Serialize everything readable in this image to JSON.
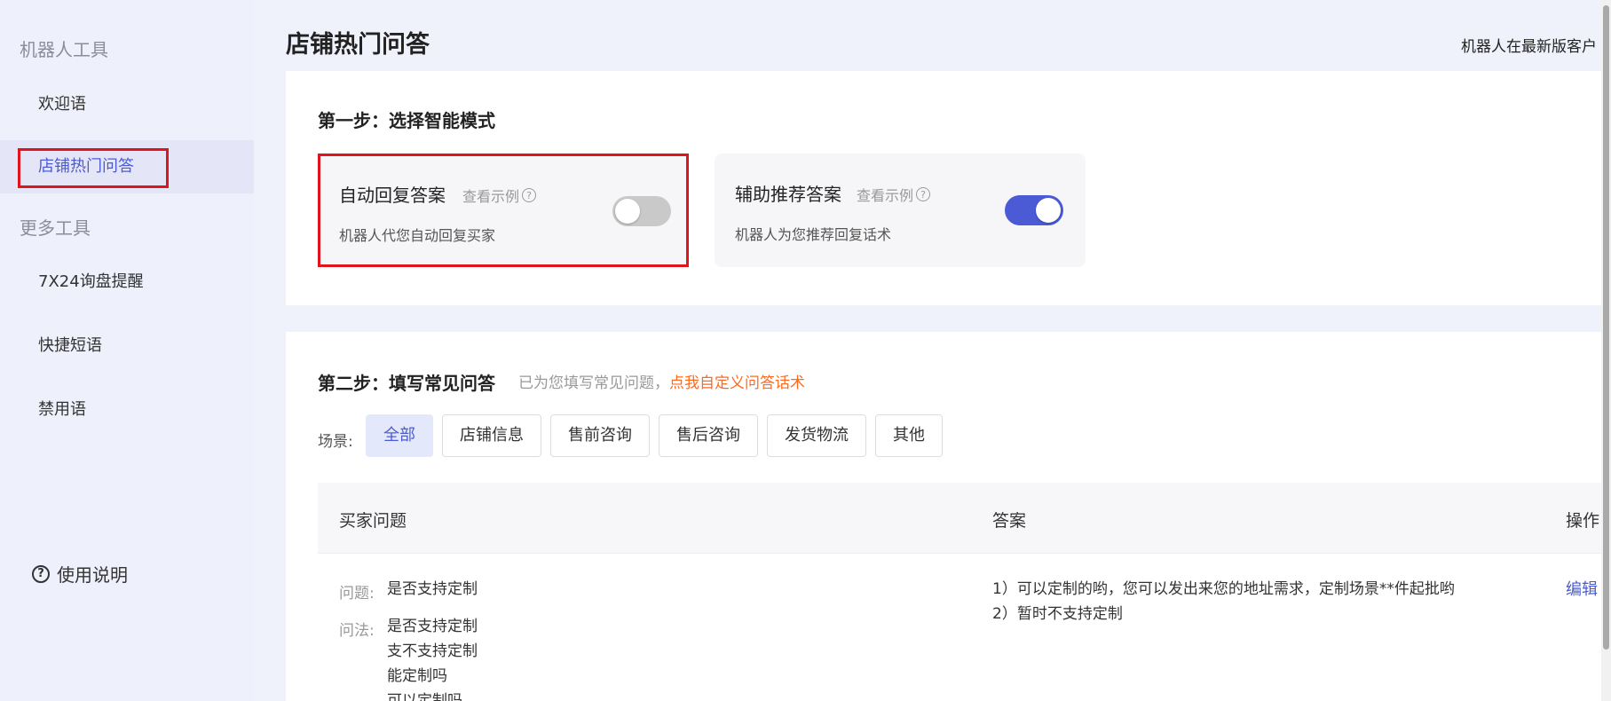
{
  "sidebar": {
    "group1": "机器人工具",
    "items1": [
      "欢迎语",
      "店铺热门问答"
    ],
    "group2": "更多工具",
    "items2": [
      "7X24询盘提醒",
      "快捷短语",
      "禁用语"
    ],
    "help": "使用说明",
    "help_icon": "?"
  },
  "header": {
    "title": "店铺热门问答",
    "top_right": "机器人在最新版客户"
  },
  "step1": {
    "title": "第一步：选择智能模式",
    "modes": [
      {
        "name": "自动回复答案",
        "example": "查看示例",
        "desc": "机器人代您自动回复买家",
        "enabled": false
      },
      {
        "name": "辅助推荐答案",
        "example": "查看示例",
        "desc": "机器人为您推荐回复话术",
        "enabled": true
      }
    ],
    "q_icon": "?"
  },
  "step2": {
    "title": "第二步：填写常见问答",
    "hint": "已为您填写常见问题，",
    "link": "点我自定义问答话术",
    "scene_label": "场景:",
    "chips": [
      "全部",
      "店铺信息",
      "售前咨询",
      "售后咨询",
      "发货物流",
      "其他"
    ],
    "active_chip": "全部",
    "table": {
      "headers": [
        "买家问题",
        "答案",
        "操作"
      ],
      "rows": [
        {
          "question_label": "问题:",
          "question": "是否支持定制",
          "asks_label": "问法:",
          "asks": [
            "是否支持定制",
            "支不支持定制",
            "能定制吗",
            "可以定制吗"
          ],
          "answers": [
            "1）可以定制的哟，您可以发出来您的地址需求，定制场景**件起批哟",
            "2）暂时不支持定制"
          ],
          "action": "编辑"
        }
      ]
    }
  },
  "colors": {
    "accent": "#4b5bd6",
    "highlight": "#e0141c",
    "link_orange": "#ff6a1f"
  }
}
